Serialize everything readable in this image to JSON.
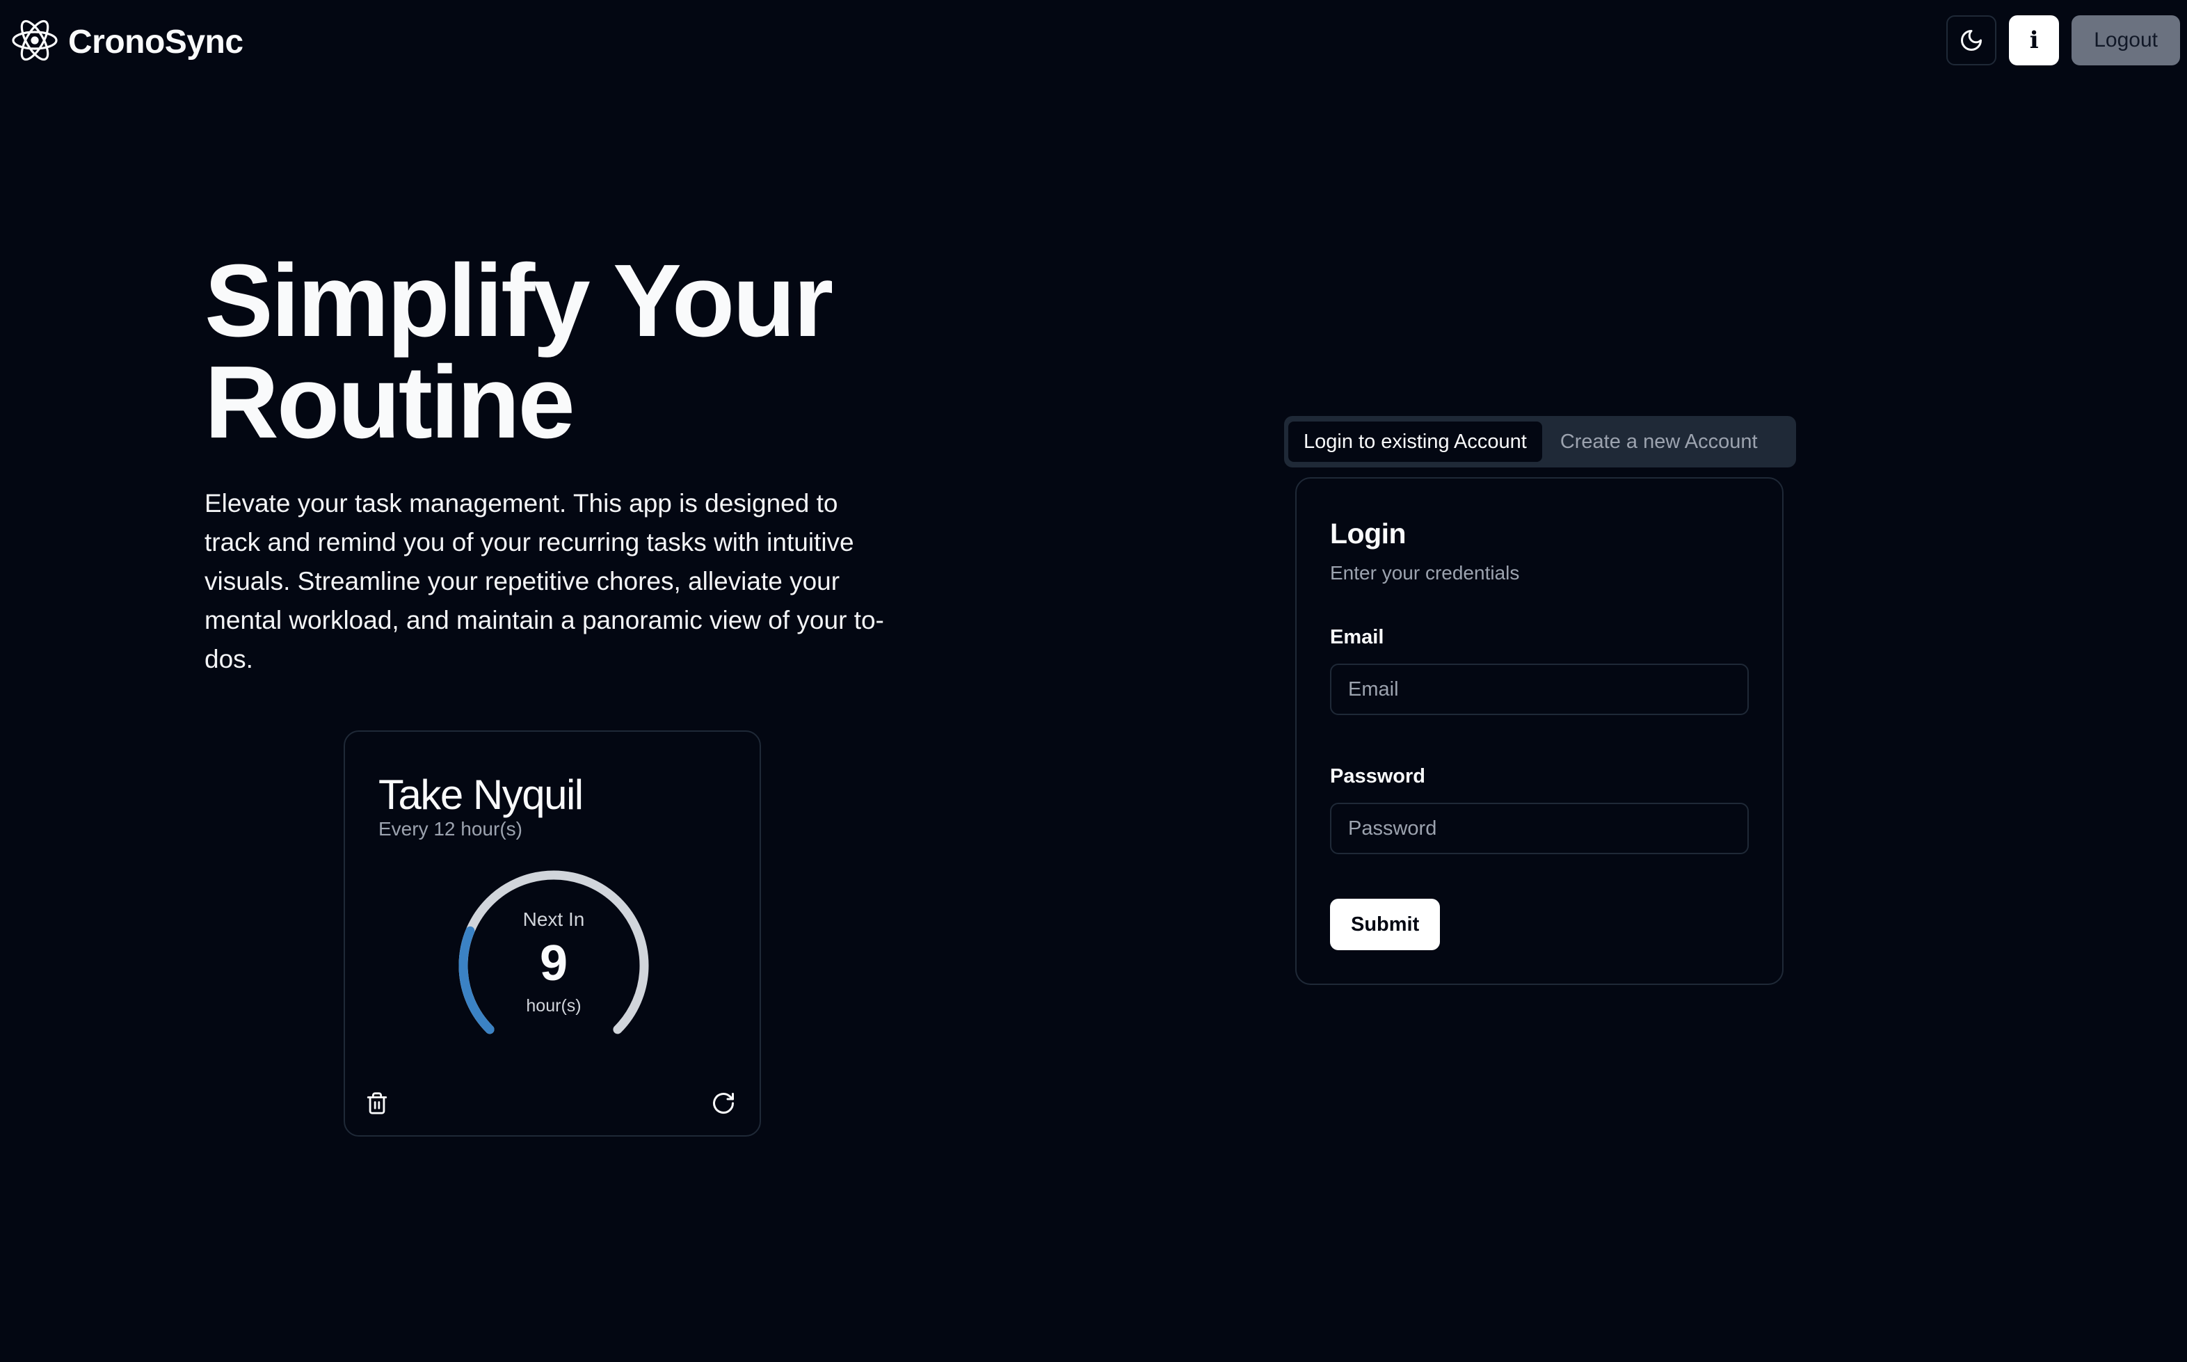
{
  "app": {
    "title": "CronoSync"
  },
  "header": {
    "info_label": "i",
    "logout_label": "Logout"
  },
  "hero": {
    "title_line1": "Simplify Your",
    "title_line2": "Routine",
    "description": "Elevate your task management. This app is designed to track and remind you of your recurring tasks with intuitive visuals. Streamline your repetitive chores, alleviate your mental workload, and maintain a panoramic view of your to-dos."
  },
  "task_card": {
    "title": "Take Nyquil",
    "subtitle": "Every 12 hour(s)",
    "next_label": "Next In",
    "next_value": "9",
    "unit": "hour(s)",
    "progress_fraction": 0.25,
    "colors": {
      "track": "#d1d5db",
      "progress": "#3b82c4"
    }
  },
  "auth": {
    "tabs": [
      {
        "label": "Login to existing Account",
        "active": true
      },
      {
        "label": "Create a new Account",
        "active": false
      }
    ],
    "card_title": "Login",
    "card_subtitle": "Enter your credentials",
    "email_label": "Email",
    "email_placeholder": "Email",
    "password_label": "Password",
    "password_placeholder": "Password",
    "submit_label": "Submit"
  }
}
